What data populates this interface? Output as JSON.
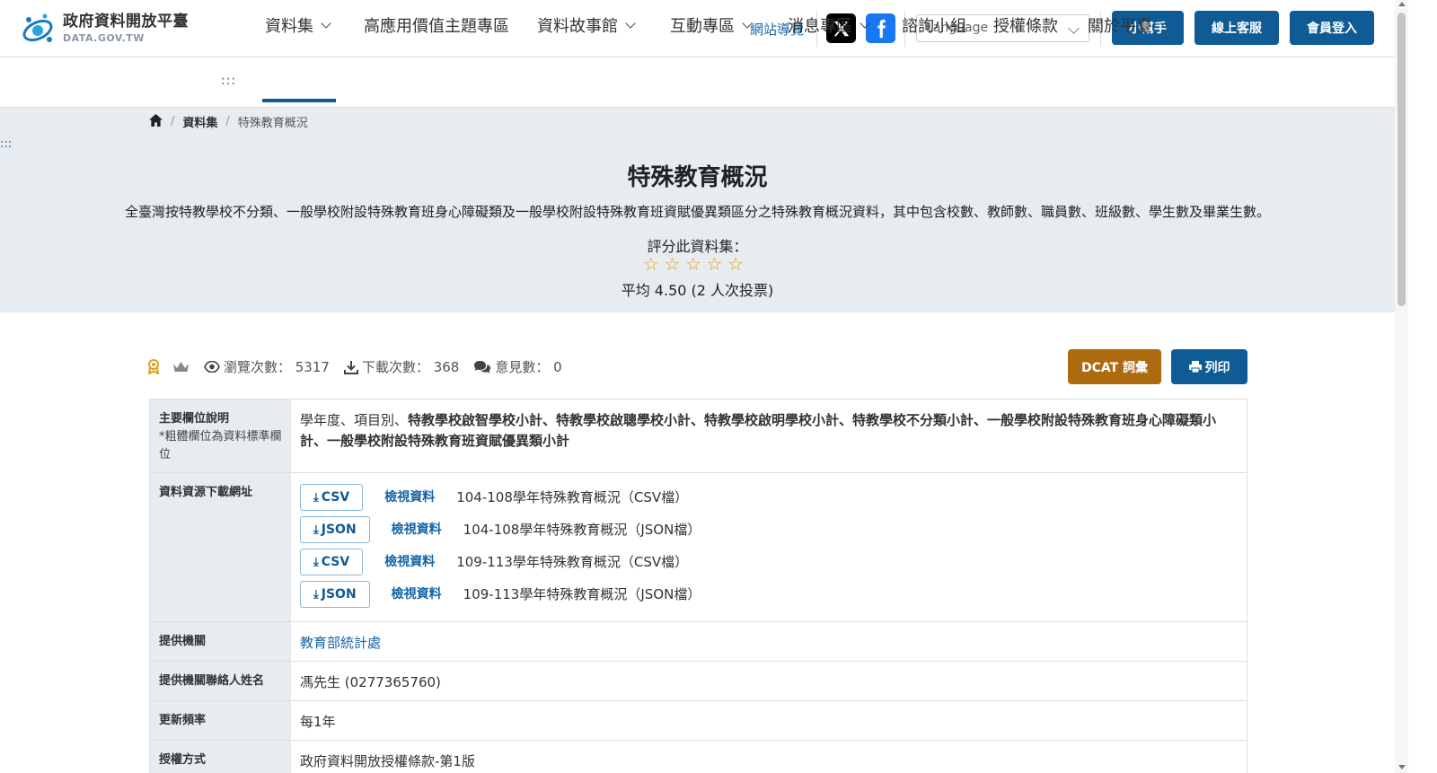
{
  "header": {
    "logo_cn": "政府資料開放平臺",
    "logo_en": "DATA.GOV.TW",
    "sitemap": "網站導覽",
    "language_placeholder": "Language",
    "helper_button": "小幫手",
    "service_button": "線上客服",
    "login_button": "會員登入",
    "brand_color": "#0f5b96"
  },
  "nav": {
    "accesskey": ":::",
    "items": [
      {
        "label": "資料集"
      },
      {
        "label": "高應用價值主題專區"
      },
      {
        "label": "資料故事館"
      },
      {
        "label": "互動專區"
      },
      {
        "label": "消息專區"
      },
      {
        "label": "諮詢小組"
      },
      {
        "label": "授權條款"
      },
      {
        "label": "關於平臺"
      }
    ]
  },
  "breadcrumb": {
    "level1": "資料集",
    "current": "特殊教育概況"
  },
  "side_accesskey": ":::",
  "dataset": {
    "title": "特殊教育概況",
    "description": "全臺灣按特教學校不分類、一般學校附設特殊教育班身心障礙類及一般學校附設特殊教育班資賦優異類區分之特殊教育概況資料，其中包含校數、教師數、職員數、班級數、學生數及畢業生數。",
    "rate_label": "評分此資料集：",
    "rating_stars": 5,
    "rating_avg": "平均 4.50 (2 人次投票)"
  },
  "stats": {
    "views": "瀏覽次數： 5317",
    "downloads": "下載次數： 368",
    "comments": "意見數： 0"
  },
  "actions": {
    "dcat": "DCAT 詞彙",
    "print": "列印"
  },
  "table": {
    "fields_label": "主要欄位說明",
    "fields_note": "*粗體欄位為資料標準欄位",
    "fields_plain": "學年度、項目別、",
    "fields_bold": "特教學校啟智學校小計、特教學校啟聰學校小計、特教學校啟明學校小計、特教學校不分類小計、一般學校附設特殊教育班身心障礙類小計、一般學校附設特殊教育班資賦優異類小計",
    "resources_label": "資料資源下載網址",
    "resources": [
      {
        "format": "CSV",
        "view": "檢視資料",
        "name": "104-108學年特殊教育概況（CSV檔）"
      },
      {
        "format": "JSON",
        "view": "檢視資料",
        "name": "104-108學年特殊教育概況（JSON檔）"
      },
      {
        "format": "CSV",
        "view": "檢視資料",
        "name": "109-113學年特殊教育概況（CSV檔）"
      },
      {
        "format": "JSON",
        "view": "檢視資料",
        "name": "109-113學年特殊教育概況（JSON檔）"
      }
    ],
    "agency_label": "提供機關",
    "agency": "教育部統計處",
    "contact_label": "提供機關聯絡人姓名",
    "contact": "馮先生 (0277365760)",
    "frequency_label": "更新頻率",
    "frequency": "每1年",
    "license_label": "授權方式",
    "license": "政府資料開放授權條款-第1版"
  }
}
